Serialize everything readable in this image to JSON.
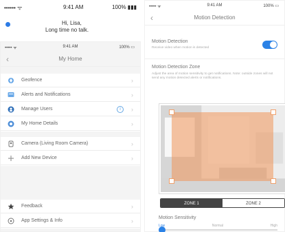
{
  "left_snippet": {
    "status": {
      "left": "•••••• ᯤ",
      "center": "9:41 AM",
      "right": "100% ▮▮▮"
    },
    "message": {
      "line1": "Hi, Lisa,",
      "line2": "Long time no talk."
    }
  },
  "left_phone": {
    "status": {
      "left": "••••• ᯤ",
      "center": "9:41 AM",
      "right": "100% ▭"
    },
    "nav": {
      "back": "‹",
      "title": "My Home"
    },
    "groups": [
      {
        "items": [
          {
            "icon": "geofence-icon",
            "label": "Geofence"
          },
          {
            "icon": "alerts-icon",
            "label": "Alerts and Notifications"
          },
          {
            "icon": "users-icon",
            "label": "Manage Users",
            "badge": "i"
          },
          {
            "icon": "home-details-icon",
            "label": "My Home Details"
          }
        ]
      },
      {
        "items": [
          {
            "icon": "camera-icon",
            "label": "Camera (Living Room Camera)"
          },
          {
            "icon": "add-icon",
            "label": "Add New Device"
          }
        ]
      },
      {
        "items": [
          {
            "icon": "star-icon",
            "label": "Feedback"
          },
          {
            "icon": "settings-icon",
            "label": "App Settings & Info"
          }
        ]
      }
    ],
    "chevron": "›"
  },
  "right_phone": {
    "status": {
      "left": "••••• ᯤ",
      "center": "9:41 AM",
      "right": "100% ▭"
    },
    "nav": {
      "back": "‹",
      "title": "Motion Detection"
    },
    "motion": {
      "title": "Motion Detection",
      "subtitle": "Receive video when motion is detected",
      "enabled": true
    },
    "zone": {
      "title": "Motion Detection Zone",
      "description": "Adjust the area of motion sensitivity to get notifications. Note: outside zones will not send any motion detected alerts or notifications."
    },
    "segments": [
      "ZONE 1",
      "ZONE 2"
    ],
    "sensitivity": {
      "title": "Motion Sensitivity",
      "low": "Low",
      "normal": "Normal",
      "high": "High",
      "level": 0
    }
  },
  "colors": {
    "accent": "#2b82e6",
    "zone_overlay": "#f0965a"
  }
}
